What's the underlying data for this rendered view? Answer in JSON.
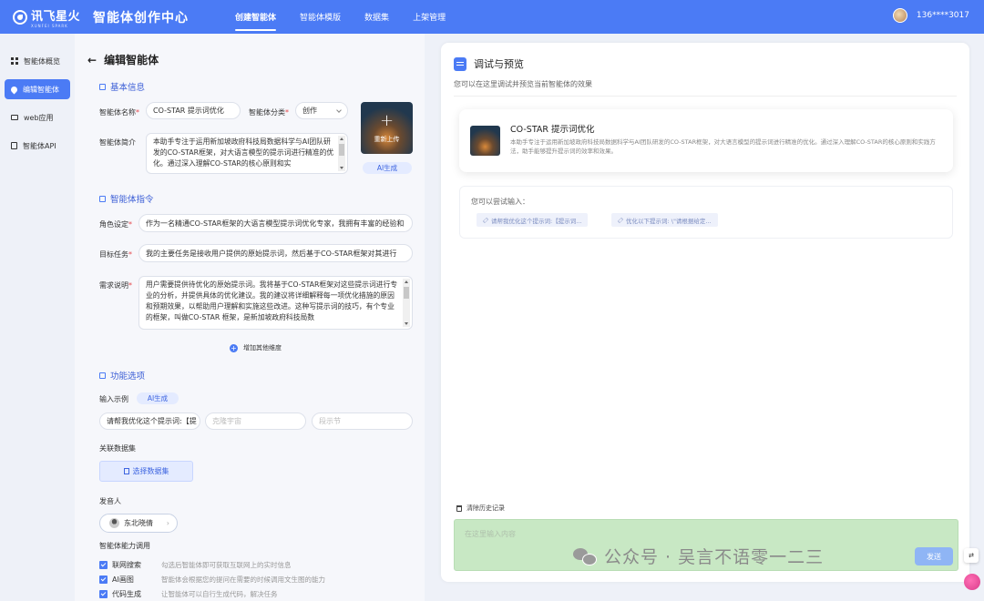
{
  "topbar": {
    "logo_text": "讯飞星火",
    "logo_sub": "XUNFEI SPARK",
    "app_title": "智能体创作中心",
    "nav": [
      "创建智能体",
      "智能体模版",
      "数据集",
      "上架管理"
    ],
    "user": "136****3017"
  },
  "sidebar": {
    "items": [
      {
        "label": "智能体概览",
        "icon": "grid-icon"
      },
      {
        "label": "编辑智能体",
        "icon": "drop-icon"
      },
      {
        "label": "web应用",
        "icon": "monitor-icon"
      },
      {
        "label": "智能体API",
        "icon": "api-doc-icon"
      }
    ]
  },
  "editor": {
    "title": "编辑智能体",
    "basic_section": "基本信息",
    "name_label": "智能体名称",
    "name_value": "CO-STAR 提示词优化",
    "category_label": "智能体分类",
    "category_value": "创作",
    "intro_label": "智能体简介",
    "intro_value": "本助手专注于运用新加坡政府科技局数据科学与AI团队研发的CO-STAR框架，对大语言模型的提示词进行精准的优化。通过深入理解CO-STAR的核心原则和实",
    "upload_label": "重新上传",
    "ai_generate": "AI生成",
    "instructions_section": "智能体指令",
    "role_label": "角色设定",
    "role_value": "作为一名精通CO-STAR框架的大语言模型提示词优化专家，我拥有丰富的经验和",
    "goal_label": "目标任务",
    "goal_value": "我的主要任务是接收用户提供的原始提示词，然后基于CO-STAR框架对其进行",
    "need_label": "需求说明",
    "need_value": "用户需要提供待优化的原始提示词。我将基于CO-STAR框架对这些提示词进行专业的分析，并提供具体的优化建议。我的建议将详细解释每一项优化措施的原因和预期效果，以帮助用户理解和实施这些改进。这种写提示词的技巧，有个专业的框架，叫做CO-STAR 框架，是新加坡政府科技局数",
    "add_dimension": "增加其他维度",
    "features_section": "功能选项",
    "example_label": "输入示例",
    "example_1": "请帮我优化这个提示词:【提",
    "example_2_placeholder": "克隆宇宙",
    "example_3_placeholder": "段示节",
    "dataset_label": "关联数据集",
    "dataset_button": "选择数据集",
    "voice_label": "发音人",
    "voice_value": "东北晓倩",
    "ability_label": "智能体能力调用",
    "abilities": [
      {
        "name": "联网搜索",
        "desc": "勾选后智能体即可获取互联网上的实时信息"
      },
      {
        "name": "AI画图",
        "desc": "智能体会根据您的提问在需要的时候调用文生图的能力"
      },
      {
        "name": "代码生成",
        "desc": "让智能体可以自行生成代码，解决任务"
      }
    ]
  },
  "preview": {
    "title": "调试与预览",
    "subtitle": "您可以在这里调试并预览当前智能体的效果",
    "agent_name": "CO-STAR 提示词优化",
    "agent_desc": "本助手专注于运用新加坡政府科技局数据科学与AI团队研发的CO-STAR框架，对大语言模型的提示词进行精准的优化。通过深入理解CO-STAR的核心原则和实践方法，助手能够提升提示词的效率和效果。",
    "try_label": "您可以尝试输入：",
    "try_chips": [
      "请帮我优化这个提示词:【提示词...",
      "优化以下提示词: \\\"请根据给定..."
    ],
    "clear_history": "清除历史记录",
    "input_placeholder": "在这里输入内容",
    "send_label": "发送"
  },
  "watermark": "公众号 · 吴言不语零一二三",
  "colors": {
    "primary": "#4b7bf5",
    "required": "#e5484d"
  }
}
